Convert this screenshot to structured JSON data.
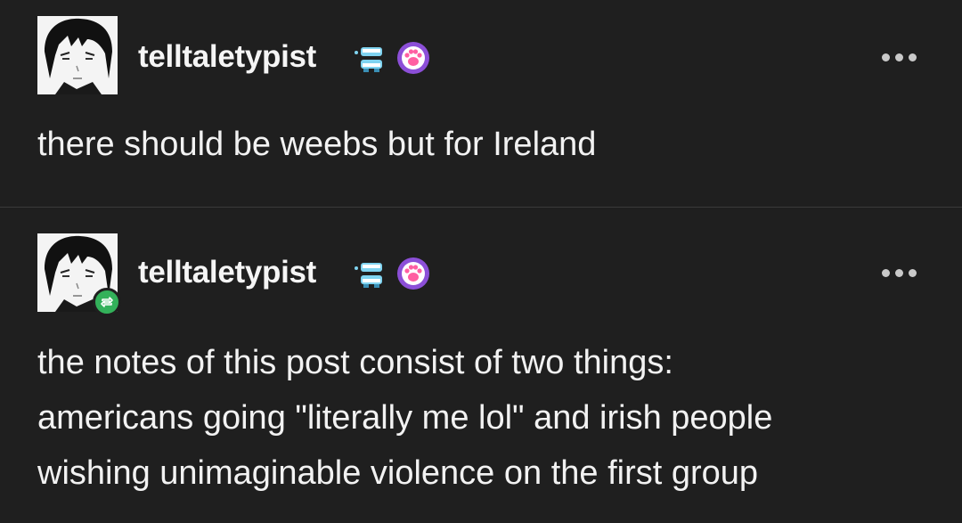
{
  "posts": [
    {
      "username": "telltaletypist",
      "lines": [
        "there should be weebs but for Ireland"
      ],
      "is_reblog": false
    },
    {
      "username": "telltaletypist",
      "lines": [
        "the notes of this post consist of two things:",
        "americans going \"literally me lol\" and irish people",
        "wishing unimaginable violence on the first group"
      ],
      "is_reblog": true
    }
  ],
  "icons": {
    "badge_1": "chattering-teeth-icon",
    "badge_2": "paw-print-badge-icon",
    "menu": "more-options-icon",
    "reblog": "reblog-icon"
  },
  "colors": {
    "background": "#1f1f1f",
    "text": "#f2f2f2",
    "reblog_green": "#33b15a",
    "paw_badge": "#8c4fd8",
    "divider": "#3a3a3a"
  }
}
